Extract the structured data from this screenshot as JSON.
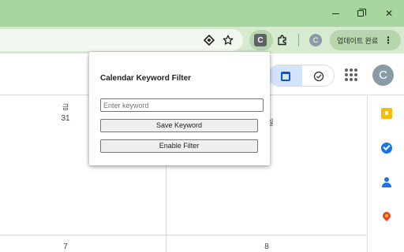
{
  "browser": {
    "window_controls": {
      "minimize": "–",
      "restore": "❐",
      "close": "✕"
    },
    "toolbar": {
      "extension_letter": "C",
      "profile_letter": "C",
      "update_label": "업데이트 완료",
      "menu_glyph": "⋮"
    }
  },
  "calendar": {
    "day_header": "금",
    "cells": {
      "top_left_date": "31",
      "top_right_fragment": "1일",
      "bottom_left_date": "7",
      "bottom_right_date": "8"
    },
    "avatar_letter": "C",
    "task_glyph": "✓"
  },
  "popup": {
    "title": "Calendar Keyword Filter",
    "input_placeholder": "Enter keyword",
    "input_value": "",
    "save_label": "Save Keyword",
    "enable_label": "Enable Filter"
  },
  "colors": {
    "titlebar": "#a8d5a0",
    "toolbar": "#d6ebd0",
    "accent_blue": "#0b57d0"
  }
}
